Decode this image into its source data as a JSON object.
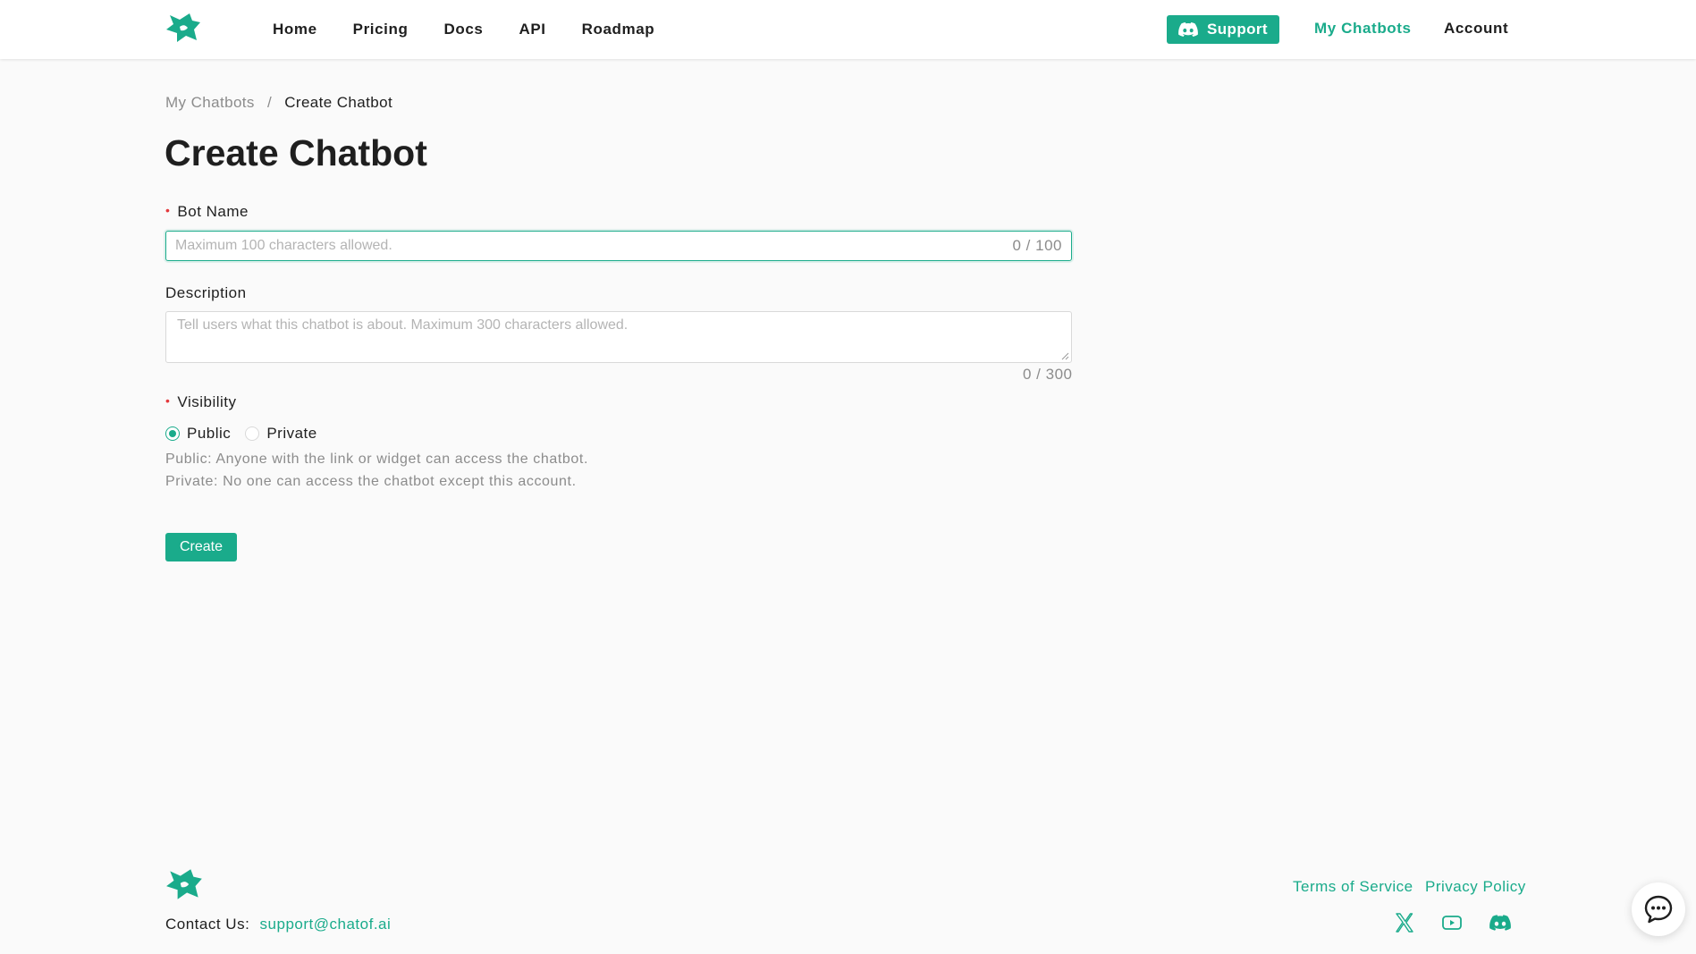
{
  "colors": {
    "accent": "#1aab8b",
    "required": "#e4393c",
    "muted": "#8c8c8c"
  },
  "header": {
    "nav": [
      "Home",
      "Pricing",
      "Docs",
      "API",
      "Roadmap"
    ],
    "support_label": "Support",
    "my_chatbots_label": "My Chatbots",
    "account_label": "Account"
  },
  "breadcrumb": {
    "parent": "My Chatbots",
    "separator": "/",
    "current": "Create Chatbot"
  },
  "page_title": "Create Chatbot",
  "form": {
    "bot_name": {
      "label": "Bot Name",
      "required": true,
      "value": "",
      "placeholder": "Maximum 100 characters allowed.",
      "counter": "0 / 100"
    },
    "description": {
      "label": "Description",
      "value": "",
      "placeholder": "Tell users what this chatbot is about. Maximum 300 characters allowed.",
      "counter": "0 / 300"
    },
    "visibility": {
      "label": "Visibility",
      "required": true,
      "options": [
        "Public",
        "Private"
      ],
      "selected": "Public",
      "help_public": "Public: Anyone with the link or widget can access the chatbot.",
      "help_private": "Private: No one can access the chatbot except this account."
    },
    "submit_label": "Create"
  },
  "footer": {
    "contact_label": "Contact Us:",
    "contact_email": "support@chatof.ai",
    "terms_label": "Terms of Service",
    "privacy_label": "Privacy Policy",
    "social_icons": [
      "x-icon",
      "youtube-icon",
      "discord-icon"
    ]
  },
  "icons": {
    "chat_fab": "chat-bubble-icon",
    "support": "discord-icon",
    "logo": "star-logo-icon"
  }
}
